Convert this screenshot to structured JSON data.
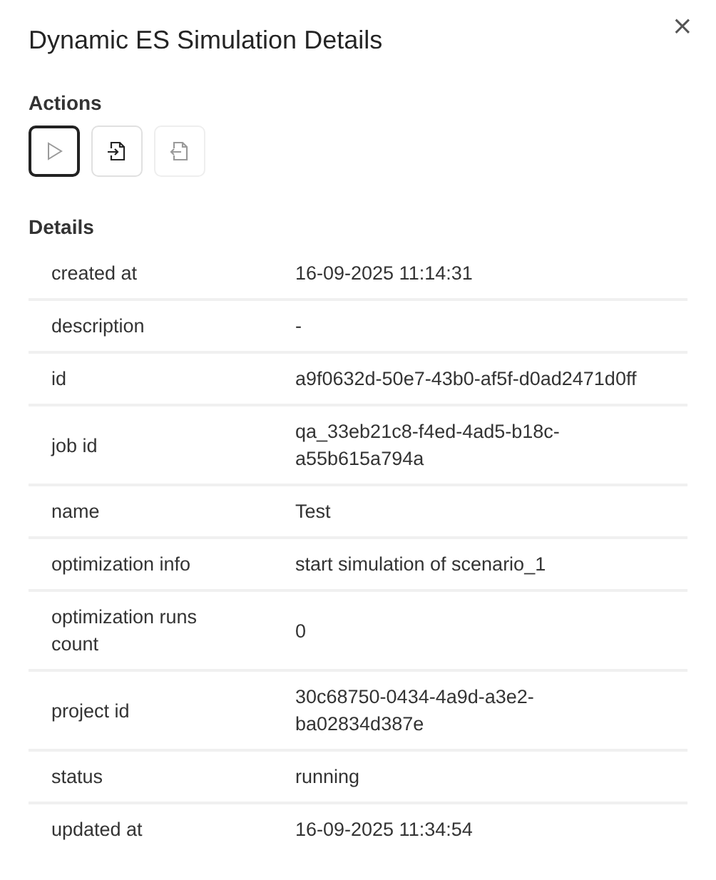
{
  "dialog": {
    "title": "Dynamic ES Simulation Details",
    "close": "×"
  },
  "actions": {
    "heading": "Actions",
    "buttons": [
      {
        "kind": "play",
        "focused": true,
        "disabled": false
      },
      {
        "kind": "import",
        "focused": false,
        "disabled": false
      },
      {
        "kind": "export",
        "focused": false,
        "disabled": true
      }
    ]
  },
  "details": {
    "heading": "Details",
    "rows": [
      {
        "label": "created at",
        "value": "16-09-2025 11:14:31"
      },
      {
        "label": "description",
        "value": "-"
      },
      {
        "label": "id",
        "value": "a9f0632d-50e7-43b0-af5f-d0ad2471d0ff"
      },
      {
        "label": "job id",
        "value": "qa_33eb21c8-f4ed-4ad5-b18c-a55b615a794a"
      },
      {
        "label": "name",
        "value": "Test"
      },
      {
        "label": "optimization info",
        "value": "start simulation of scenario_1"
      },
      {
        "label": "optimization runs count",
        "value": "0"
      },
      {
        "label": "project id",
        "value": "30c68750-0434-4a9d-a3e2-ba02834d387e"
      },
      {
        "label": "status",
        "value": "running"
      },
      {
        "label": "updated at",
        "value": "16-09-2025 11:34:54"
      }
    ]
  }
}
